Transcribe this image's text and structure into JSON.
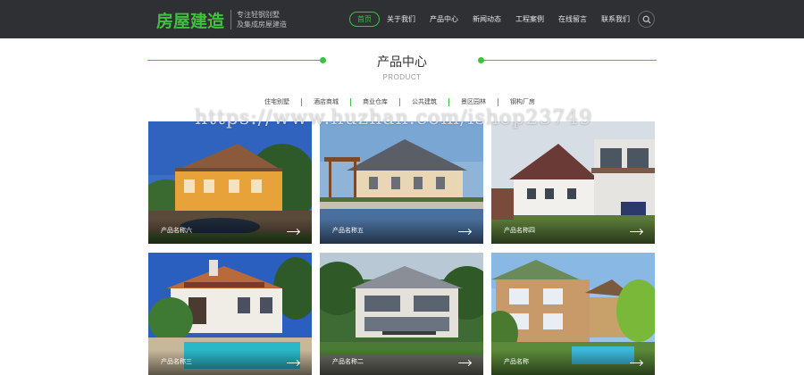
{
  "header": {
    "logo": "房屋建造",
    "slogan_line1": "专注轻钢别墅",
    "slogan_line2": "及集成房屋建造",
    "nav": [
      {
        "label": "首页",
        "active": true
      },
      {
        "label": "关于我们"
      },
      {
        "label": "产品中心"
      },
      {
        "label": "新闻动态"
      },
      {
        "label": "工程案例"
      },
      {
        "label": "在线留言"
      },
      {
        "label": "联系我们"
      }
    ]
  },
  "section": {
    "title": "产品中心",
    "subtitle": "PRODUCT"
  },
  "categories": [
    "住宅别墅",
    "酒店商城",
    "商业仓库",
    "公共建筑",
    "景区园林",
    "钢构厂房"
  ],
  "watermark": "https://www.huzhan.com/ishop23749",
  "products": [
    {
      "name": "产品名称六"
    },
    {
      "name": "产品名称五"
    },
    {
      "name": "产品名称四"
    },
    {
      "name": "产品名称三"
    },
    {
      "name": "产品名称二"
    },
    {
      "name": "产品名称"
    }
  ],
  "colors": {
    "accent": "#3cc23c",
    "header_bg": "#2e3033"
  }
}
